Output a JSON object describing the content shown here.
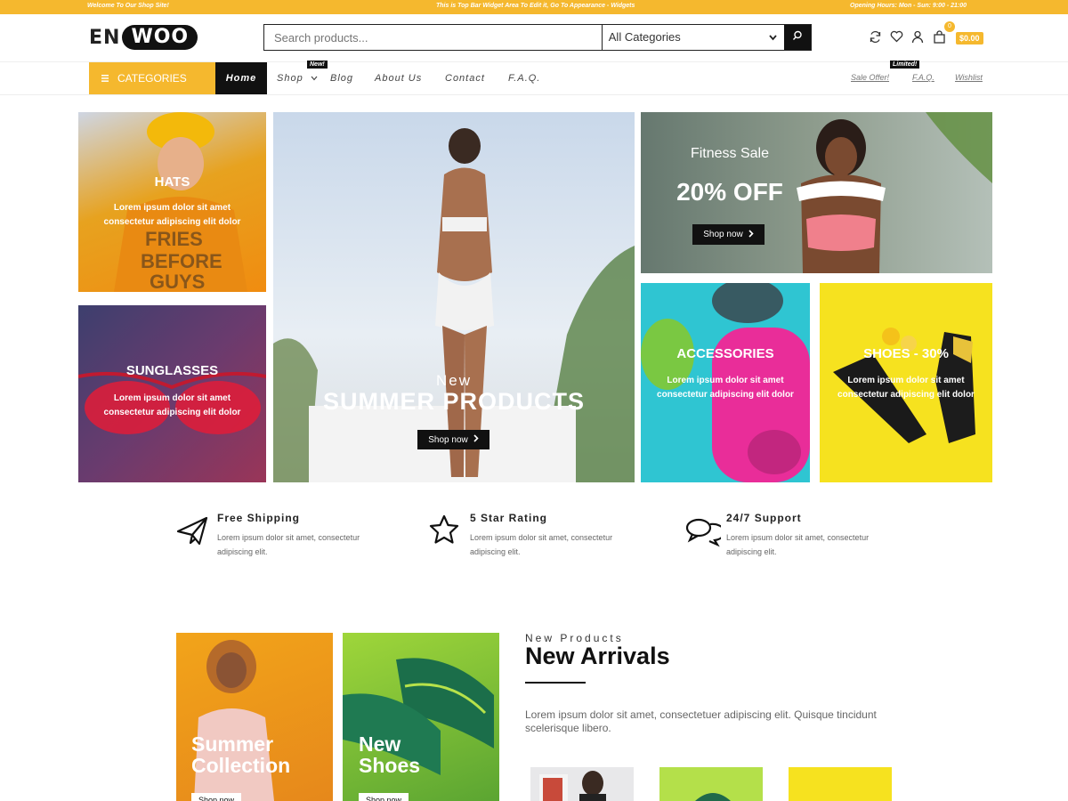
{
  "topbar": {
    "welcome": "Welcome To Our Shop Site!",
    "widget_notice": "This is Top Bar Widget Area To Edit it, Go To Appearance - Widgets",
    "hours": "Opening Hours: Mon - Sun: 9:00 - 21:00"
  },
  "header": {
    "logo_en": "EN",
    "logo_woo": "WOO",
    "search_placeholder": "Search products...",
    "category_select": "All Categories",
    "cart_count": "0",
    "cart_total": "$0.00"
  },
  "nav": {
    "categories": "CATEGORIES",
    "items": [
      "Home",
      "Shop",
      "Blog",
      "About Us",
      "Contact",
      "F.A.Q."
    ],
    "shop_tag": "New!",
    "right_items": [
      "Sale Offer!",
      "F.A.Q.",
      "Wishlist"
    ],
    "right_tag": "Limited!"
  },
  "banners": {
    "hats": {
      "title": "HATS",
      "desc": "Lorem ipsum dolor sit amet consectetur adipiscing elit dolor"
    },
    "sunglasses": {
      "title": "SUNGLASSES",
      "desc": "Lorem ipsum dolor sit amet consectetur adipiscing elit dolor"
    },
    "summer": {
      "kicker": "New",
      "title": "SUMMER PRODUCTS",
      "button": "Shop now"
    },
    "fitness": {
      "kicker": "Fitness Sale",
      "title": "20% OFF",
      "button": "Shop now"
    },
    "accessories": {
      "title": "ACCESSORIES",
      "desc": "Lorem ipsum dolor sit amet consectetur adipiscing elit dolor"
    },
    "shoes": {
      "title": "SHOES - 30%",
      "desc": "Lorem ipsum dolor sit amet consectetur adipiscing elit dolor"
    }
  },
  "features": [
    {
      "title": "Free Shipping",
      "desc": "Lorem ipsum dolor sit amet, consectetur adipiscing elit.",
      "icon": "paper-plane-icon"
    },
    {
      "title": "5 Star Rating",
      "desc": "Lorem ipsum dolor sit amet, consectetur adipiscing elit.",
      "icon": "star-icon"
    },
    {
      "title": "24/7 Support",
      "desc": "Lorem ipsum dolor sit amet, consectetur adipiscing elit.",
      "icon": "chat-icon"
    }
  ],
  "collections": [
    {
      "title_line1": "Summer",
      "title_line2": "Collection",
      "button": "Shop now"
    },
    {
      "title_line1": "New",
      "title_line2": "Shoes",
      "button": "Shop now"
    }
  ],
  "arrivals": {
    "kicker": "New Products",
    "title": "New Arrivals",
    "desc": "Lorem ipsum dolor sit amet, consectetuer adipiscing elit. Quisque tincidunt scelerisque libero."
  },
  "colors": {
    "accent": "#f5b82e",
    "dark": "#111111"
  }
}
